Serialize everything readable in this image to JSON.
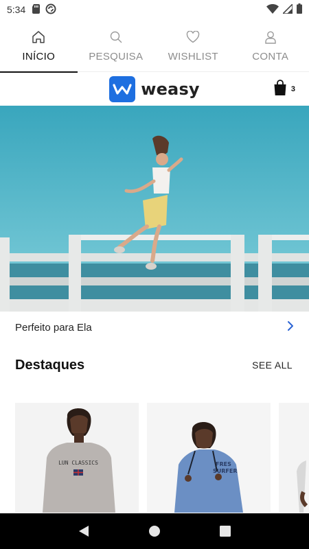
{
  "status_bar": {
    "time": "5:34",
    "icons_left": [
      "sd-card-icon",
      "sync-icon"
    ],
    "icons_right": [
      "wifi-icon",
      "signal-icon",
      "battery-icon"
    ]
  },
  "tabs": [
    {
      "label": "INÍCIO",
      "icon": "home-icon",
      "active": true
    },
    {
      "label": "PESQUISA",
      "icon": "search-icon",
      "active": false
    },
    {
      "label": "WISHLIST",
      "icon": "heart-icon",
      "active": false
    },
    {
      "label": "CONTA",
      "icon": "user-icon",
      "active": false
    }
  ],
  "header": {
    "logo_text": "weasy",
    "cart_count": "3"
  },
  "banner": {
    "caption": "Perfeito para Ela"
  },
  "featured": {
    "title": "Destaques",
    "see_all": "SEE ALL",
    "products": [
      {
        "shirt_text_line1": "LUN CLASSICS",
        "shirt_color": "#b9b4b1"
      },
      {
        "shirt_text_line1": "FRES",
        "shirt_text_line2": "SURFER",
        "shirt_color": "#6b8fc4"
      },
      {
        "shirt_color": "#d8d8d8"
      }
    ]
  },
  "colors": {
    "brand": "#1e6fe0",
    "sky": "#4fb3c6",
    "sea": "#3f8ea0"
  },
  "system_nav": [
    "back-icon",
    "home-circle-icon",
    "recents-icon"
  ]
}
